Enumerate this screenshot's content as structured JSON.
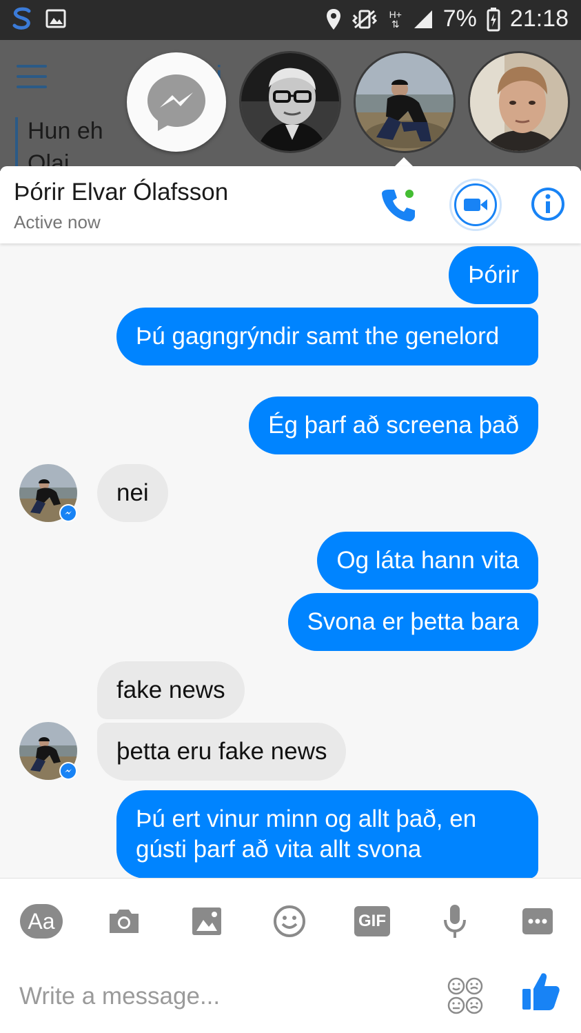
{
  "status_bar": {
    "battery": "7%",
    "time": "21:18",
    "network": "H+"
  },
  "background_app": {
    "text_line_1": "Hun eh",
    "text_line_2": "Olai",
    "title_fragment": "ri"
  },
  "header": {
    "name": "Þórir Elvar Ólafsson",
    "status": "Active now"
  },
  "messages": [
    {
      "dir": "out",
      "text": "Þórir"
    },
    {
      "dir": "out",
      "text": "Þú gagngrýndir samt the genelord"
    },
    {
      "dir": "out",
      "text": "Ég þarf að screena það"
    },
    {
      "dir": "in",
      "text": "nei"
    },
    {
      "dir": "out",
      "text": "Og láta hann vita"
    },
    {
      "dir": "out",
      "text": "Svona er þetta bara"
    },
    {
      "dir": "in",
      "text": "fake news"
    },
    {
      "dir": "in",
      "text": "þetta eru fake news"
    },
    {
      "dir": "out",
      "text": "Þú ert vinur minn og allt það, en gústi þarf að vita allt svona"
    }
  ],
  "composer": {
    "placeholder": "Write a message...",
    "text_tool_label": "Aa",
    "gif_label": "GIF"
  },
  "colors": {
    "accent": "#0084ff",
    "incoming_bubble": "#e9e9e9",
    "active_dot": "#44bd32"
  }
}
